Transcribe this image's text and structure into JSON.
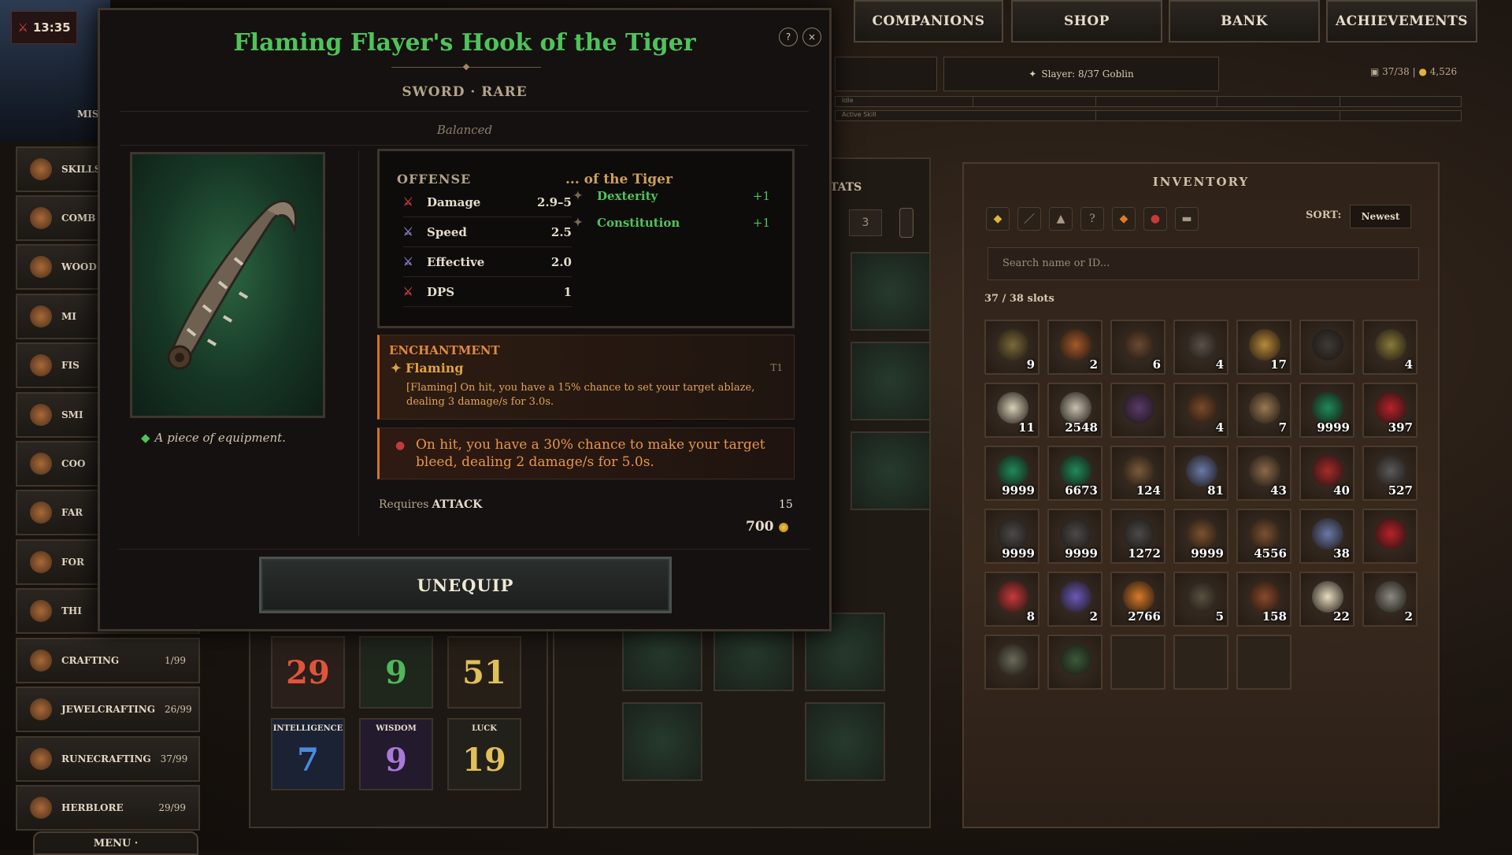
{
  "hud": {
    "timer": "13:35",
    "slayer": "Slayer: 8/37 Goblin",
    "slots_readout": "37/38",
    "gold_readout": "4,526",
    "bar1_label": "Idle",
    "bar2_label": "Active Skill"
  },
  "nav": {
    "companions": "COMPANIONS",
    "shop": "SHOP",
    "bank": "BANK",
    "achievements": "ACHIEVEMENTS"
  },
  "sidebar": {
    "items": [
      {
        "label": "SKILLS"
      },
      {
        "label": "COMB"
      },
      {
        "label": "WOOD"
      },
      {
        "label": "MI"
      },
      {
        "label": "FIS"
      },
      {
        "label": "SMI"
      },
      {
        "label": "COO"
      },
      {
        "label": "FAR"
      },
      {
        "label": "FOR"
      },
      {
        "label": "THI"
      },
      {
        "label": "CRAFTING",
        "level": "1/99"
      },
      {
        "label": "JEWELCRAFTING",
        "level": "26/99"
      },
      {
        "label": "RUNECRAFTING",
        "level": "37/99"
      },
      {
        "label": "HERBLORE",
        "level": "29/99"
      }
    ],
    "menu": "MENU ·",
    "mis_label": "MIS"
  },
  "stats": {
    "top": [
      "29",
      "9",
      "51"
    ],
    "bottom": [
      {
        "label": "INTELLIGENCE",
        "value": "7"
      },
      {
        "label": "WISDOM",
        "value": "9"
      },
      {
        "label": "LUCK",
        "value": "19"
      }
    ],
    "header": "TATS",
    "count": "3"
  },
  "inventory": {
    "title": "INVENTORY",
    "sort_label": "SORT:",
    "sort_value": "Newest",
    "search_placeholder": "Search name or ID...",
    "slots": "37 / 38 slots",
    "items": [
      {
        "qty": "9",
        "color": "#7a6a3a"
      },
      {
        "qty": "2",
        "color": "#a4592a"
      },
      {
        "qty": "6",
        "color": "#6b4a32"
      },
      {
        "qty": "4",
        "color": "#5a5048"
      },
      {
        "qty": "17",
        "color": "#b88a3a"
      },
      {
        "qty": "",
        "color": "#3e3a36"
      },
      {
        "qty": "4",
        "color": "#8a7a3a"
      },
      {
        "qty": "11",
        "color": "#d8cfb8"
      },
      {
        "qty": "2548",
        "color": "#c8c0b0"
      },
      {
        "qty": "",
        "color": "#5a3a6a"
      },
      {
        "qty": "4",
        "color": "#7a4a2a"
      },
      {
        "qty": "7",
        "color": "#9a7a52"
      },
      {
        "qty": "9999",
        "color": "#1e8a5a"
      },
      {
        "qty": "397",
        "color": "#b8222a"
      },
      {
        "qty": "9999",
        "color": "#1e8a5a"
      },
      {
        "qty": "6673",
        "color": "#1e8a5a"
      },
      {
        "qty": "124",
        "color": "#7a5a3a"
      },
      {
        "qty": "81",
        "color": "#6a7aa8"
      },
      {
        "qty": "43",
        "color": "#8a6a4a"
      },
      {
        "qty": "40",
        "color": "#a82a2a"
      },
      {
        "qty": "527",
        "color": "#5a5a5a"
      },
      {
        "qty": "9999",
        "color": "#4a4a4a"
      },
      {
        "qty": "9999",
        "color": "#4a4a4a"
      },
      {
        "qty": "1272",
        "color": "#4a4a4a"
      },
      {
        "qty": "9999",
        "color": "#7a5230"
      },
      {
        "qty": "4556",
        "color": "#7a5230"
      },
      {
        "qty": "38",
        "color": "#6a7aa8"
      },
      {
        "qty": "",
        "color": "#b8222a"
      },
      {
        "qty": "8",
        "color": "#c83a3a"
      },
      {
        "qty": "2",
        "color": "#6a5ab8"
      },
      {
        "qty": "2766",
        "color": "#d87a2a"
      },
      {
        "qty": "5",
        "color": "#5a5040"
      },
      {
        "qty": "158",
        "color": "#8a4a2a"
      },
      {
        "qty": "22",
        "color": "#e8dcc0"
      },
      {
        "qty": "2",
        "color": "#8a8a82"
      },
      {
        "qty": "",
        "color": "#6a6a5a"
      },
      {
        "qty": "",
        "color": "#3a5a3a"
      }
    ]
  },
  "item": {
    "name": "Flaming Flayer's Hook of the Tiger",
    "type": "SWORD · RARE",
    "modifier": "Balanced",
    "description": "A piece of equipment.",
    "offense_label": "OFFENSE",
    "stats": [
      {
        "name": "Damage",
        "value": "2.9–5"
      },
      {
        "name": "Speed",
        "value": "2.5"
      },
      {
        "name": "Effective",
        "value": "2.0"
      },
      {
        "name": "DPS",
        "value": "1"
      }
    ],
    "suffix_label": "... of the Tiger",
    "affixes": [
      {
        "name": "Dexterity",
        "value": "+1"
      },
      {
        "name": "Constitution",
        "value": "+1"
      }
    ],
    "enchantment_label": "ENCHANTMENT",
    "enchantment_name": "✦ Flaming",
    "enchantment_tier": "T1",
    "enchantment_text": "[Flaming] On hit, you have a 15% chance to set your target ablaze, dealing 3 damage/s for 3.0s.",
    "bleed_text": "On hit, you have a 30% chance to make your target bleed, dealing 2 damage/s for 5.0s.",
    "requires_label": "Requires",
    "requires_skill": "ATTACK",
    "requires_level": "15",
    "price": "700",
    "unequip_label": "UNEQUIP",
    "help": "?",
    "close": "×"
  }
}
